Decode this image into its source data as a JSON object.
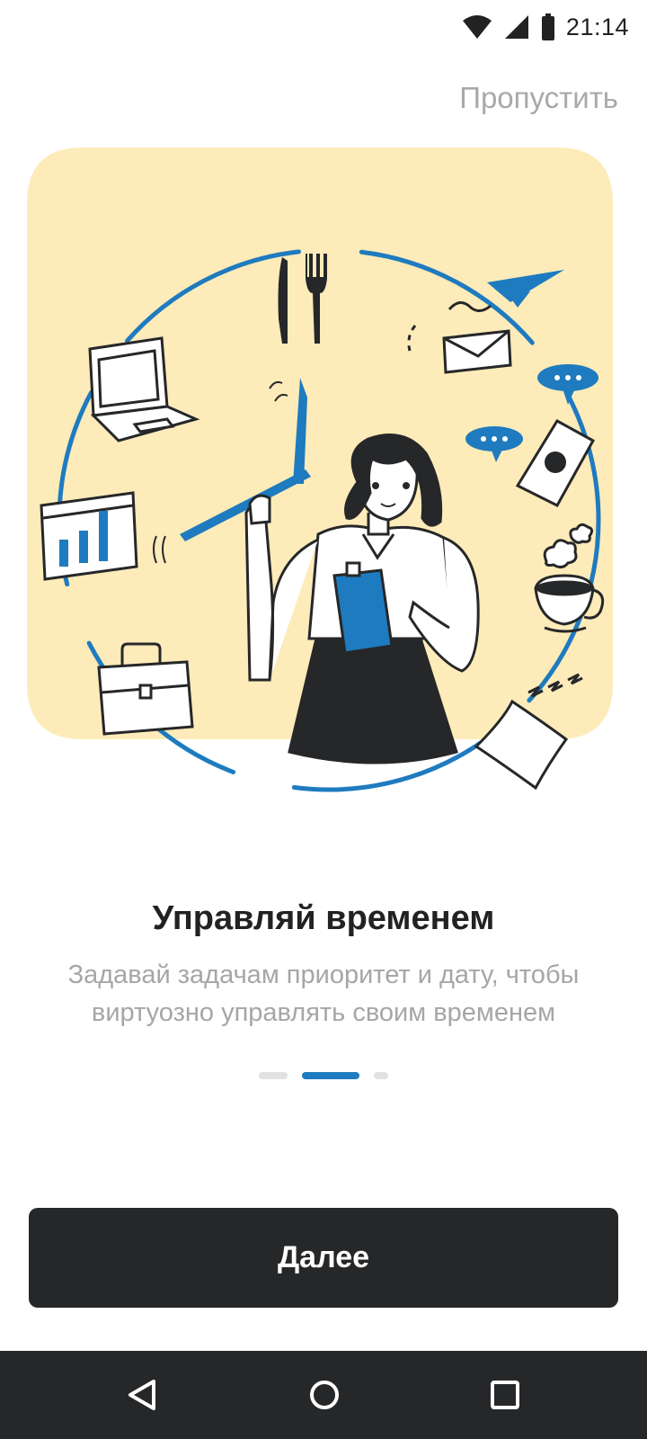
{
  "status_bar": {
    "time": "21:14"
  },
  "header": {
    "skip_label": "Пропустить"
  },
  "onboarding": {
    "title": "Управляй временем",
    "subtitle_line1": "Задавай задачам приоритет и дату, чтобы",
    "subtitle_line2": "виртуозно управлять своим временем",
    "page_indicator": {
      "total": 3,
      "active": 2
    }
  },
  "footer": {
    "next_label": "Далее"
  },
  "icons": {
    "status": [
      "wifi-icon",
      "signal-icon",
      "battery-icon"
    ],
    "illustration": [
      "knife-fork-icon",
      "laptop-icon",
      "paper-plane-icon",
      "envelope-icon",
      "chat-bubble-icon",
      "phone-icon",
      "chart-icon",
      "coffee-cup-icon",
      "briefcase-icon",
      "pillow-icon",
      "clock-hand-icon",
      "clipboard-icon"
    ],
    "nav": [
      "back-icon",
      "home-icon",
      "recents-icon"
    ]
  },
  "colors": {
    "accent": "#1e7bbf",
    "illustration_bg": "#fdebb9",
    "button_bg": "#262729",
    "muted_text": "#a6a6a6"
  }
}
